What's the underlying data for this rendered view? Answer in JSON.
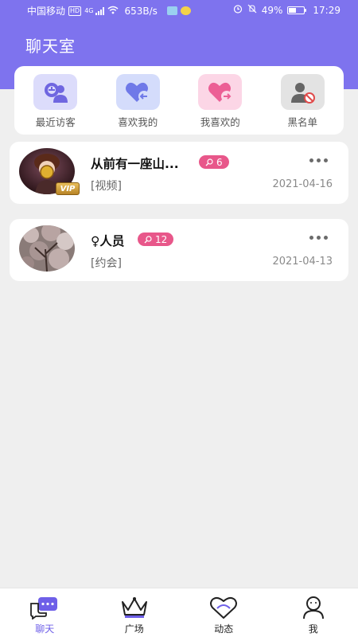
{
  "status_bar": {
    "carrier": "中国移动",
    "hd": "HD",
    "net": "4G",
    "speed": "653B/s",
    "battery": "49%",
    "battery_level": 0.49,
    "time": "17:29"
  },
  "header": {
    "title": "聊天室",
    "bg_color": "#7e73ee"
  },
  "quick_actions": [
    {
      "label": "最近访客",
      "icon": "visitor-icon",
      "bg": "#dcdcfb"
    },
    {
      "label": "喜欢我的",
      "icon": "liked-me-icon",
      "bg": "#d4dcfb"
    },
    {
      "label": "我喜欢的",
      "icon": "i-like-icon",
      "bg": "#fcd6e6"
    },
    {
      "label": "黑名单",
      "icon": "blacklist-icon",
      "bg": "#e3e3e3"
    }
  ],
  "chats": [
    {
      "name": "从前有一座山...",
      "count": "6",
      "tag": "[视频]",
      "date": "2021-04-16",
      "vip": "VIP"
    },
    {
      "name": "♀人员",
      "count": "12",
      "tag": "[约会]",
      "date": "2021-04-13"
    }
  ],
  "bottom_nav": [
    {
      "label": "聊天",
      "icon": "chat-icon",
      "active": true
    },
    {
      "label": "广场",
      "icon": "crown-icon",
      "active": false
    },
    {
      "label": "动态",
      "icon": "heart-icon",
      "active": false
    },
    {
      "label": "我",
      "icon": "profile-icon",
      "active": false
    }
  ],
  "colors": {
    "accent": "#7e73ee",
    "badge": "#e8578a",
    "active_nav": "#6e5fe8"
  }
}
